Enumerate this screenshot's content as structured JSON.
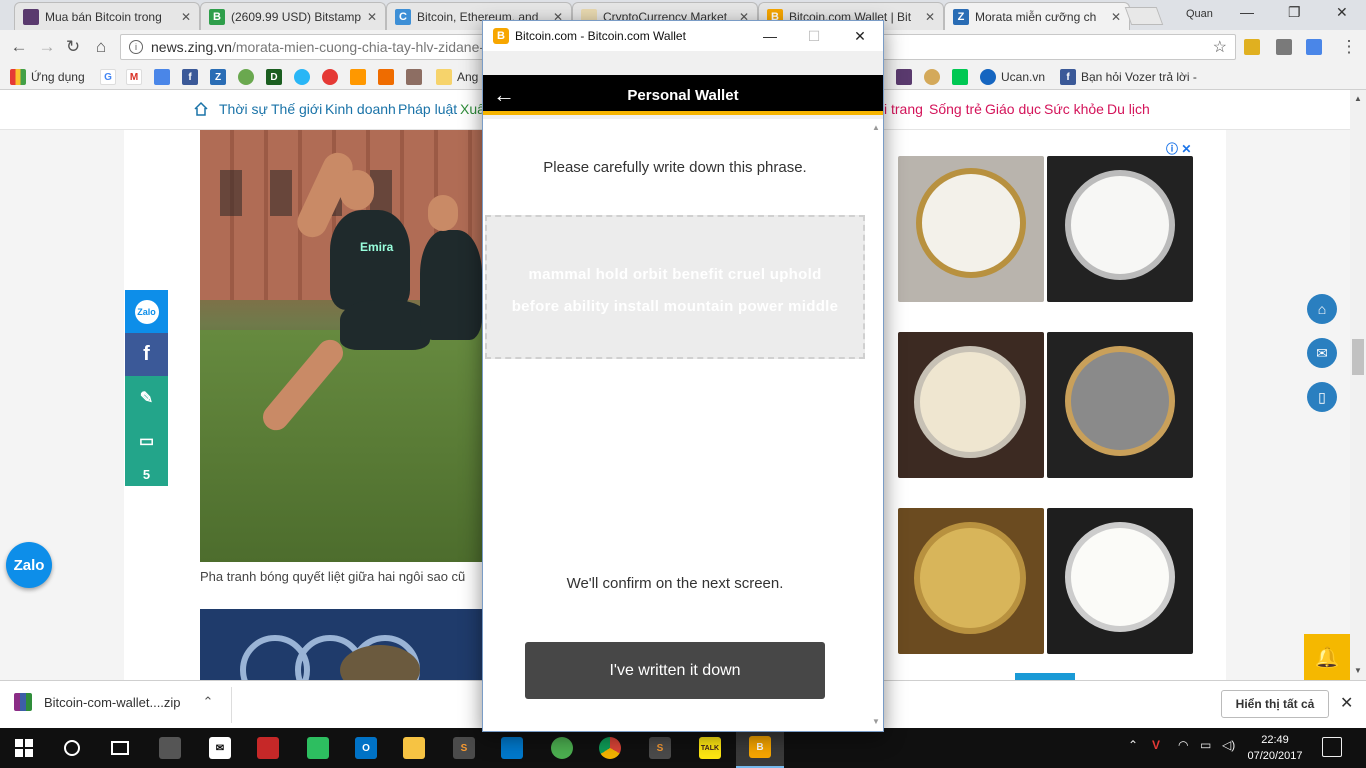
{
  "browser": {
    "tabs": [
      {
        "label": "Mua bán Bitcoin trong",
        "color": "#5a3a6e",
        "glyph": ""
      },
      {
        "label": "(2609.99 USD) Bitstamp",
        "color": "#2e9e4a",
        "glyph": "B"
      },
      {
        "label": "Bitcoin, Ethereum, and",
        "color": "#3d8fd6",
        "glyph": "C"
      },
      {
        "label": "CryptoCurrency Market",
        "color": "#e9d9b0",
        "glyph": ""
      },
      {
        "label": "Bitcoin.com Wallet | Bit",
        "color": "#f7a600",
        "glyph": "B"
      },
      {
        "label": "Morata miễn cưỡng ch",
        "color": "#2a6db5",
        "glyph": "Z"
      }
    ],
    "profile": "Quan",
    "url": {
      "host": "news.zing.vn",
      "path": "/morata-mien-cuong-chia-tay-hlv-zidane-"
    },
    "bookmarks": {
      "apps": "Ứng dụng",
      "truncated": "Ang",
      "ucan": "Ucan.vn",
      "fb": "Bạn hỏi Vozer trả lời -"
    }
  },
  "site": {
    "nav": [
      "Thời sự",
      "Thế giới",
      "Kinh doanh",
      "Pháp luật",
      "Xuấ"
    ],
    "nav_right": [
      "i trang",
      "Sống trẻ",
      "Giáo dục",
      "Sức khỏe",
      "Du lịch"
    ],
    "caption": "Pha tranh bóng quyết liệt giữa hai ngôi sao cũ",
    "share_count": "5",
    "zalo": "Zalo",
    "shirt_text": "Emira"
  },
  "popup": {
    "window_title": "Bitcoin.com - Bitcoin.com Wallet",
    "app_title": "Personal Wallet",
    "instruction": "Please carefully write down this phrase.",
    "phrase_line1": "mammal hold orbit benefit cruel uphold",
    "phrase_line2": "before ability install mountain power middle",
    "confirm_note": "We'll confirm on the next screen.",
    "done_button": "I've written it down"
  },
  "downloads": {
    "file": "Bitcoin-com-wallet....zip",
    "show_all": "Hiển thị tất cả"
  },
  "taskbar": {
    "time": "22:49",
    "date": "07/20/2017"
  },
  "colors": {
    "bitcoin_orange": "#f7a600",
    "wallet_header": "#000000",
    "accent_yellow": "#f7b500",
    "button_dark": "#474747",
    "link_blue": "#1a73a8",
    "link_red": "#d4145a"
  }
}
